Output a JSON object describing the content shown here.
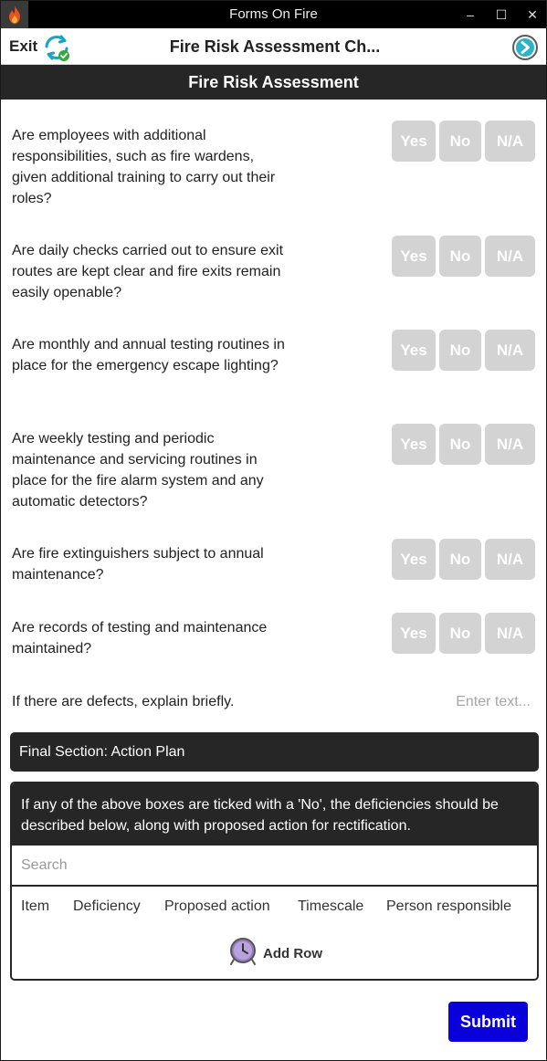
{
  "window": {
    "title": "Forms On Fire",
    "minimize": "–",
    "maximize": "☐",
    "close": "✕"
  },
  "appbar": {
    "exit_label": "Exit",
    "form_title": "Fire Risk Assessment Ch..."
  },
  "section": {
    "title": "Fire Risk Assessment"
  },
  "questions": [
    {
      "text": "Are employees with additional responsibilities, such as fire wardens, given additional training to carry out their roles?",
      "yes": "Yes",
      "no": "No",
      "na": "N/A"
    },
    {
      "text": "Are daily checks carried out to ensure exit routes are kept clear and fire exits remain easily openable?",
      "yes": "Yes",
      "no": "No",
      "na": "N/A"
    },
    {
      "text": "Are monthly and annual testing routines in place for the emergency escape lighting?",
      "yes": "Yes",
      "no": "No",
      "na": "N/A"
    },
    {
      "text": "Are weekly testing and periodic maintenance and servicing routines in place for the fire alarm system and any automatic detectors?",
      "yes": "Yes",
      "no": "No",
      "na": "N/A"
    },
    {
      "text": "Are fire extinguishers subject to annual maintenance?",
      "yes": "Yes",
      "no": "No",
      "na": "N/A"
    },
    {
      "text": "Are records of testing and maintenance maintained?",
      "yes": "Yes",
      "no": "No",
      "na": "N/A"
    }
  ],
  "defects": {
    "label": "If there are defects,  explain briefly.",
    "placeholder": "Enter text..."
  },
  "final_section": {
    "title": "Final Section: Action Plan",
    "description": "If any of the above boxes are ticked with a 'No', the deficiencies should be described below, along with proposed action for rectification.",
    "search_placeholder": "Search",
    "columns": [
      "Item",
      "Deficiency",
      "Proposed action",
      "Timescale",
      "Person responsible"
    ],
    "add_row_label": "Add Row"
  },
  "submit_label": "Submit",
  "colors": {
    "dark_header": "#262626",
    "option_button": "#d3d3d3",
    "submit_button": "#0a00dc",
    "accent_teal": "#1aa3c8"
  }
}
